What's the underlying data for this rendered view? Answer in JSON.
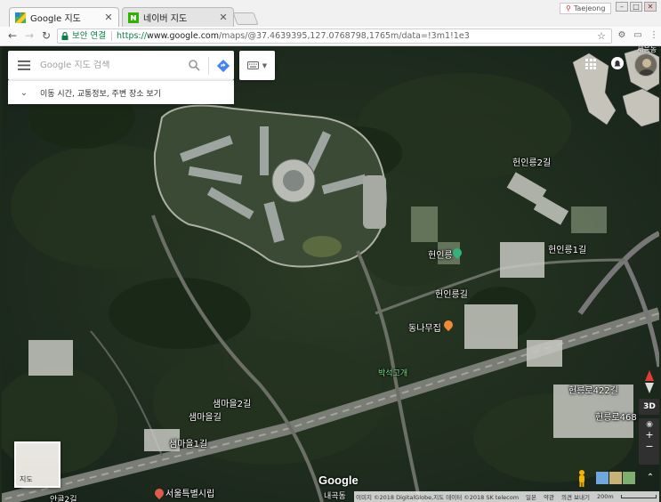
{
  "browser": {
    "tabs": [
      {
        "title": "Google 지도",
        "active": true
      },
      {
        "title": "네이버 지도",
        "active": false
      }
    ],
    "profile_name": "Taejeong",
    "url_secure_label": "보안 연결",
    "url_scheme": "https://",
    "url_host": "www.google.com",
    "url_path": "/maps/@37.4639395,127.0768798,1765m/data=!3m1!1e3",
    "colors": {
      "secure_green": "#0b8043"
    }
  },
  "maps": {
    "search_placeholder": "Google 지도 검색",
    "subbar_label": "이동 시간, 교통정보, 주변 장소 보기",
    "layer_label": "지도",
    "logo": "Google",
    "compass_n": "N",
    "btn_3d": "3D",
    "zoom_in": "+",
    "zoom_out": "−",
    "top_right_text": "세움동",
    "labels": [
      {
        "text": "헌인릉2길",
        "kind": "road"
      },
      {
        "text": "헌인릉1길",
        "kind": "road"
      },
      {
        "text": "헌인릉",
        "kind": "poi"
      },
      {
        "text": "헌인릉길",
        "kind": "road"
      },
      {
        "text": "동나무집",
        "kind": "poi"
      },
      {
        "text": "박석고개",
        "kind": "green"
      },
      {
        "text": "헌릉로422길",
        "kind": "road"
      },
      {
        "text": "헌릉로468",
        "kind": "road"
      },
      {
        "text": "샘마을2길",
        "kind": "road"
      },
      {
        "text": "샘마을길",
        "kind": "road"
      },
      {
        "text": "샘마을1길",
        "kind": "road"
      },
      {
        "text": "서울특별시립",
        "kind": "poi"
      },
      {
        "text": "내곡동",
        "kind": "road"
      },
      {
        "text": "안골2길",
        "kind": "road"
      }
    ],
    "bottom_bar": [
      "이미지 ©2018 DigitalGlobe,지도 데이터 ©2018 SK telecom",
      "일본",
      "약관",
      "의견 보내기",
      "200m"
    ],
    "poi_colors": {
      "green": "#34b27b",
      "orange": "#f08a35",
      "red": "#e25a4b"
    }
  }
}
